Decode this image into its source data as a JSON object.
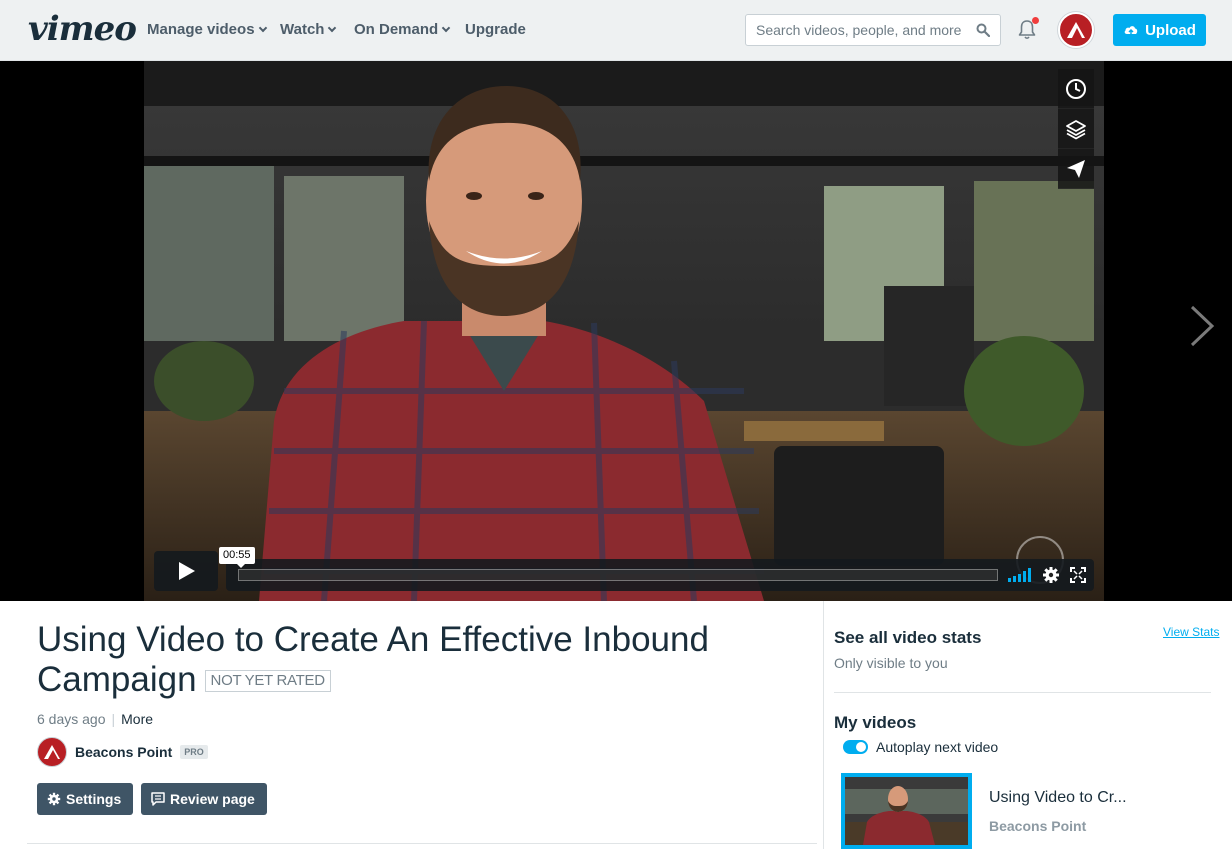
{
  "header": {
    "logo": "vimeo",
    "nav": [
      {
        "label": "Manage videos"
      },
      {
        "label": "Watch"
      },
      {
        "label": "On Demand"
      },
      {
        "label": "Upgrade"
      }
    ],
    "search_placeholder": "Search videos, people, and more",
    "upload_label": "Upload"
  },
  "player": {
    "time_tooltip": "00:55",
    "side_tools": [
      "clock-icon",
      "layers-icon",
      "send-icon"
    ]
  },
  "video": {
    "title": "Using Video to Create An Effective Inbound Campaign",
    "rating": "NOT YET RATED",
    "posted": "6 days ago",
    "more": "More",
    "owner": "Beacons Point",
    "owner_badge": "PRO",
    "settings_label": "Settings",
    "review_label": "Review page"
  },
  "sidebar": {
    "stats_title": "See all video stats",
    "stats_sub": "Only visible to you",
    "view_stats": "View Stats",
    "my_videos": "My videos",
    "autoplay_label": "Autoplay next video",
    "up_next": {
      "title": "Using Video to Cr...",
      "owner": "Beacons Point"
    }
  },
  "colors": {
    "accent": "#00adef",
    "dark_button": "#3f5566",
    "text": "#1a2e3b",
    "muted": "#6f7d86"
  }
}
